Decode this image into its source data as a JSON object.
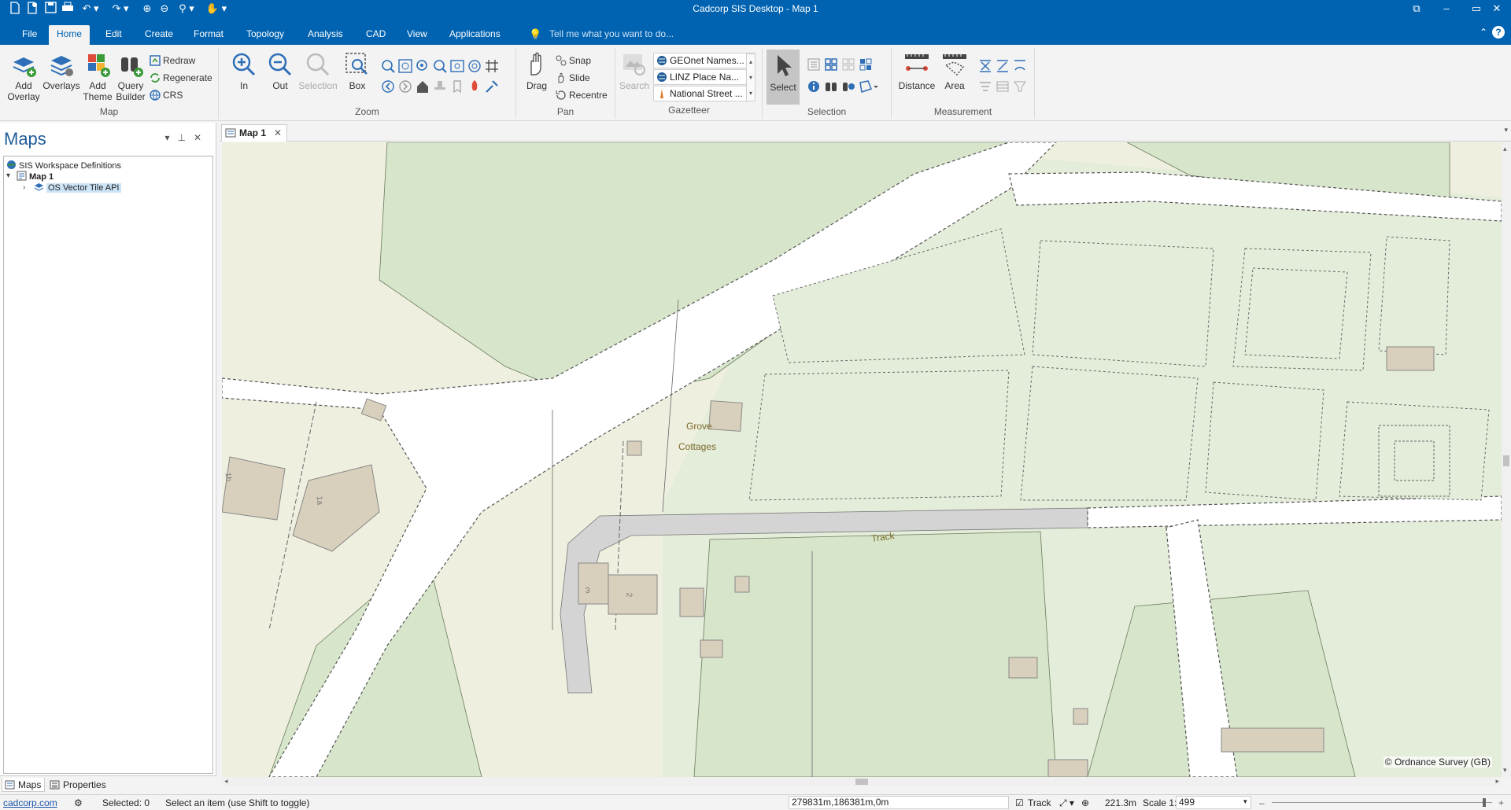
{
  "window": {
    "title": "Cadcorp SIS Desktop - Map 1",
    "quick_access": [
      "new-icon",
      "new-file-icon",
      "save-icon",
      "print-icon",
      "undo-icon",
      "redo-icon",
      "zoom-in-icon",
      "zoom-out-icon",
      "zoom-icon",
      "pan-icon"
    ]
  },
  "tabs": [
    "File",
    "Home",
    "Edit",
    "Create",
    "Format",
    "Topology",
    "Analysis",
    "CAD",
    "View",
    "Applications"
  ],
  "active_tab": "Home",
  "tell_me": "Tell me what you want to do...",
  "ribbon": {
    "map": {
      "label": "Map",
      "add_overlay": "Add\nOverlay",
      "add_overlay_l1": "Add",
      "add_overlay_l2": "Overlay",
      "overlays": "Overlays",
      "add_theme_l1": "Add",
      "add_theme_l2": "Theme",
      "query_builder_l1": "Query",
      "query_builder_l2": "Builder",
      "redraw": "Redraw",
      "regenerate": "Regenerate",
      "crs": "CRS"
    },
    "zoom": {
      "label": "Zoom",
      "in": "In",
      "out": "Out",
      "selection": "Selection",
      "box": "Box"
    },
    "pan": {
      "label": "Pan",
      "drag": "Drag",
      "snap": "Snap",
      "slide": "Slide",
      "recentre": "Recentre"
    },
    "gazetteer": {
      "label": "Gazetteer",
      "search": "Search",
      "items": [
        "GEOnet Names...",
        "LINZ Place Na...",
        "National Street ..."
      ]
    },
    "selection": {
      "label": "Selection",
      "select": "Select"
    },
    "measurement": {
      "label": "Measurement",
      "distance": "Distance",
      "area": "Area"
    }
  },
  "left_panel": {
    "title": "Maps",
    "tree": {
      "root": "SIS Workspace Definitions",
      "map": "Map 1",
      "overlay": "OS Vector Tile API"
    },
    "tabs": [
      "Maps",
      "Properties"
    ]
  },
  "document": {
    "tab": "Map 1",
    "labels": {
      "grove": "Grove",
      "cottages": "Cottages",
      "track": "Track",
      "house3": "3",
      "house2": "2",
      "house1b": "1b",
      "house1a": "1a"
    },
    "copyright": "© Ordnance Survey (GB)"
  },
  "status": {
    "link": "cadcorp.com",
    "selected": "Selected: 0",
    "hint": "Select an item (use Shift to toggle)",
    "coords": "279831m,186381m,0m",
    "track": "Track",
    "distance": "221.3m",
    "scale_label": "Scale 1:",
    "scale_value": "499"
  },
  "colors": {
    "brand": "#0063b1",
    "park": "#d9e8cf",
    "land": "#eeeedd",
    "built": "#e6ecdc",
    "road": "#ffffff",
    "building": "#d8d0bc"
  }
}
